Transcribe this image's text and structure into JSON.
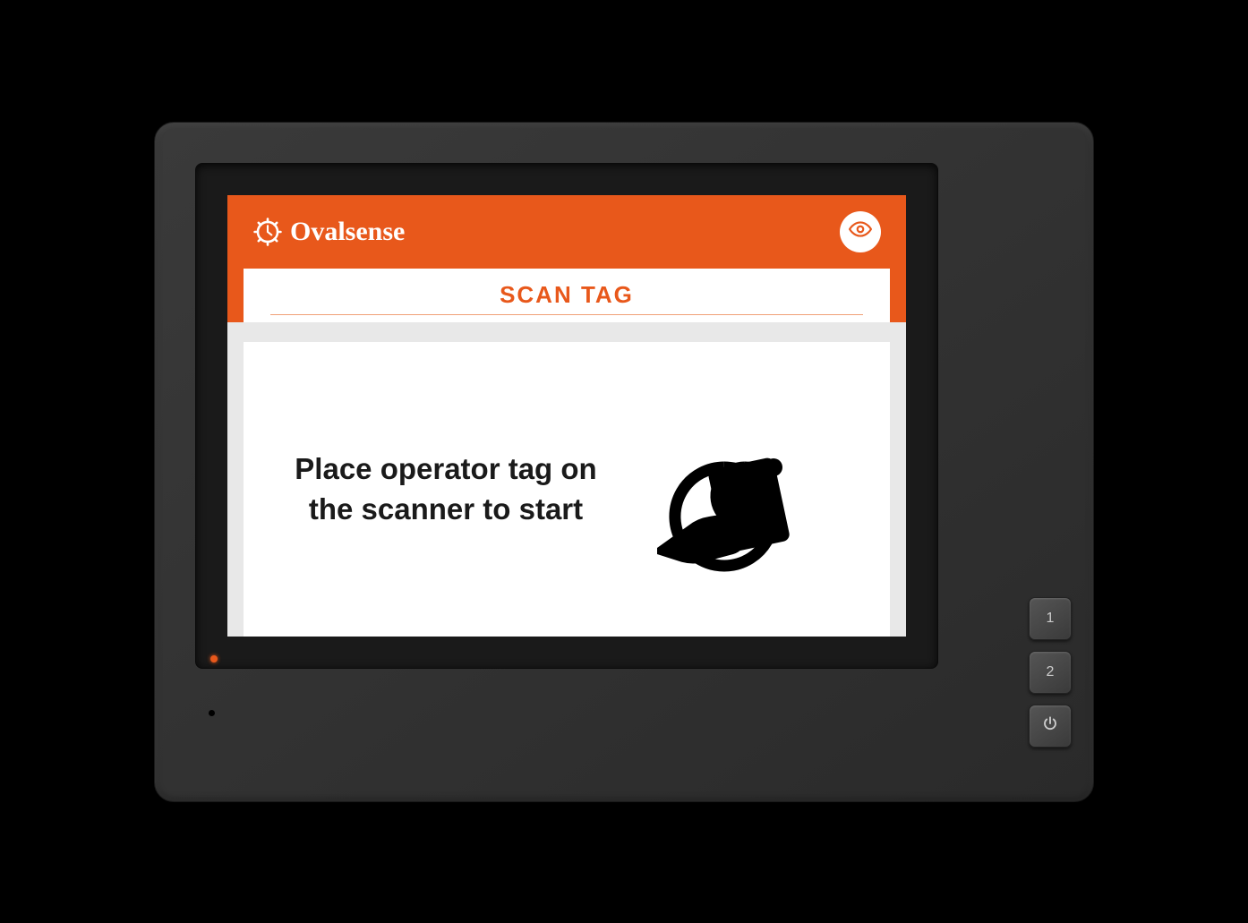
{
  "header": {
    "brand_name": "Ovalsense",
    "logo_icon": "gear-clock-icon",
    "action_icon": "eye-icon"
  },
  "title": {
    "text": "SCAN TAG"
  },
  "content": {
    "instruction": "Place operator tag on the scanner to start",
    "icon": "nfc-scan-icon"
  },
  "hardware_buttons": {
    "button1_label": "1",
    "button2_label": "2",
    "power_icon": "power-icon"
  },
  "colors": {
    "accent": "#e8581b",
    "background": "#e8e8e8"
  }
}
